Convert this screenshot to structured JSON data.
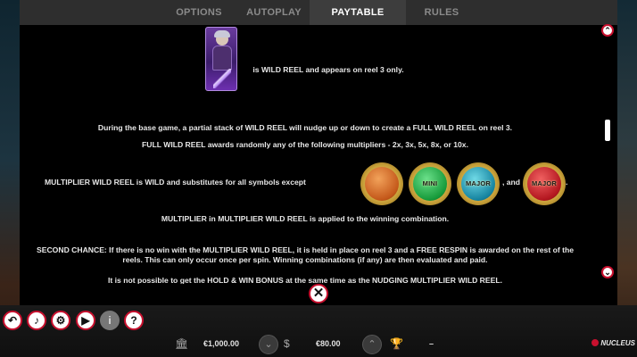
{
  "tabs": [
    {
      "label": "OPTIONS"
    },
    {
      "label": "AUTOPLAY"
    },
    {
      "label": "PAYTABLE"
    },
    {
      "label": "RULES"
    }
  ],
  "active_tab": "PAYTABLE",
  "paytable": {
    "wild_reel_text": "is WILD REEL and appears on reel 3 only.",
    "para1": "During the base game, a partial stack of WILD REEL will nudge up or down to create a FULL WILD REEL on reel 3.",
    "para2": "FULL WILD REEL awards randomly any of the following multipliers - 2x, 3x, 5x, 8x, or 10x.",
    "multiplier_text": "MULTIPLIER WILD REEL is WILD and substitutes for all symbols except",
    "and_text": ", and",
    "period": ".",
    "orbs": [
      {
        "label": "",
        "color": "#c4581a"
      },
      {
        "label": "MINI",
        "color": "#169a3a"
      },
      {
        "label": "MAJOR",
        "color": "#1684a0"
      },
      {
        "label": "MAJOR",
        "color": "#b3161f"
      }
    ],
    "para3": "MULTIPLIER in MULTIPLIER WILD REEL is applied to the winning combination.",
    "para4": "SECOND CHANCE: If there is no win with the MULTIPLIER WILD REEL, it is held in place on reel 3 and a FREE RESPIN is awarded on the rest of the reels. This can only occur once per spin. Winning combinations (if any) are then evaluated and paid.",
    "para5_partial": "It is not possible to get the HOLD & WIN BONUS at the same time as the NUDGING MULTIPLIER WILD REEL."
  },
  "toolbar": {
    "buttons": [
      "back",
      "sound",
      "settings",
      "play",
      "info",
      "help"
    ]
  },
  "bottom": {
    "balance": "€1,000.00",
    "bet": "€80.00",
    "win": "–",
    "brand": "NUCLEUS"
  },
  "colors": {
    "accent": "#c8102e",
    "tab_active": "#3d3d3d"
  }
}
